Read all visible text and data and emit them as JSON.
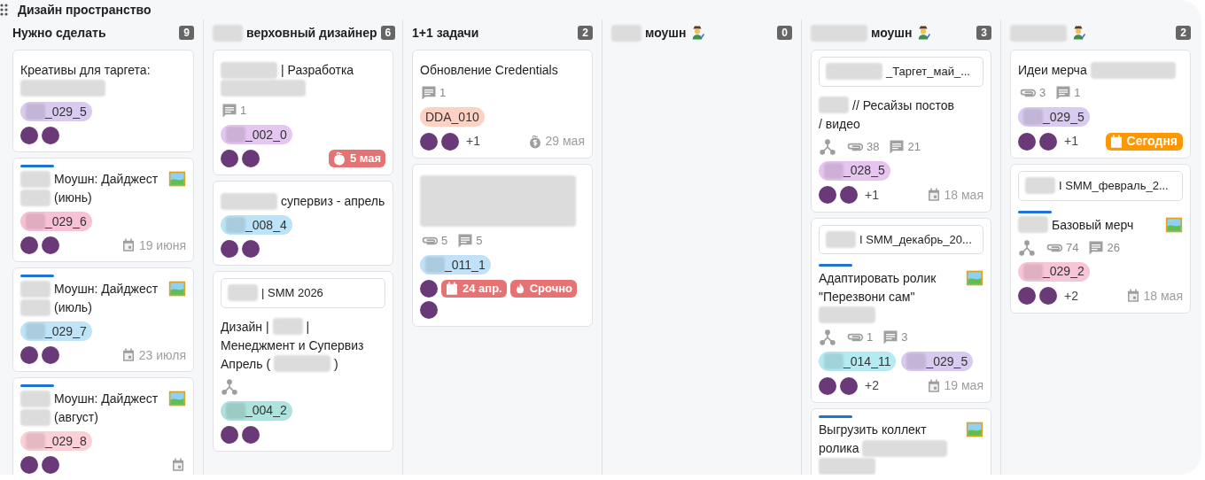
{
  "board": {
    "title": "Дизайн пространство"
  },
  "columns": [
    {
      "title": [
        {
          "kind": "text",
          "text": "Нужно сделать"
        }
      ],
      "artist": false,
      "count": "9",
      "cards": [
        {
          "bar": false,
          "image": false,
          "title": [
            {
              "kind": "text",
              "text": "Креативы для таргета:"
            },
            {
              "kind": "redacted_line"
            }
          ],
          "tags": [
            {
              "redacted": true,
              "text": "_029_5",
              "color": "#d9caef"
            }
          ],
          "avatars": [
            {
              "kind": "photo"
            },
            {
              "kind": "photo"
            }
          ]
        },
        {
          "bar": true,
          "image": true,
          "title": [
            {
              "kind": "redacted"
            },
            {
              "kind": "text",
              "text": "Моушн:"
            },
            {
              "kind": "text",
              "text": "Дайджест"
            },
            {
              "kind": "redacted"
            },
            {
              "kind": "text",
              "text": "(июнь)"
            }
          ],
          "tags": [
            {
              "redacted": true,
              "text": "_029_6",
              "color": "#f8c1d6"
            }
          ],
          "avatars": [
            {
              "kind": "photo"
            },
            {
              "kind": "photo"
            }
          ],
          "due": [
            {
              "kind": "calendar",
              "overdue": false,
              "today": false,
              "text": "19 июня"
            }
          ]
        },
        {
          "bar": true,
          "image": true,
          "title": [
            {
              "kind": "redacted"
            },
            {
              "kind": "text",
              "text": "Моушн:"
            },
            {
              "kind": "text",
              "text": "Дайджест"
            },
            {
              "kind": "redacted"
            },
            {
              "kind": "text",
              "text": "(июль)"
            }
          ],
          "tags": [
            {
              "redacted": true,
              "text": "_029_7",
              "color": "#bfe4f8"
            }
          ],
          "avatars": [
            {
              "kind": "photo"
            },
            {
              "kind": "photo"
            }
          ],
          "due": [
            {
              "kind": "calendar",
              "overdue": false,
              "today": false,
              "text": "23 июля"
            }
          ]
        },
        {
          "bar": true,
          "image": true,
          "title": [
            {
              "kind": "redacted"
            },
            {
              "kind": "text",
              "text": "Моушн:"
            },
            {
              "kind": "text",
              "text": "Дайджест"
            },
            {
              "kind": "redacted"
            },
            {
              "kind": "text",
              "text": "(август)"
            }
          ],
          "tags": [
            {
              "redacted": true,
              "text": "_029_8",
              "color": "#fdd0d8"
            }
          ],
          "avatars": [
            {
              "kind": "photo"
            },
            {
              "kind": "photo"
            }
          ],
          "due": [
            {
              "kind": "calendar",
              "overdue": false,
              "today": false
            }
          ]
        }
      ]
    },
    {
      "title": [
        {
          "kind": "redacted"
        },
        {
          "kind": "text",
          "text": "верховный дизайнер"
        }
      ],
      "artist": false,
      "count": "6",
      "cards": [
        {
          "bar": false,
          "image": false,
          "title": [
            {
              "kind": "redacted_wide"
            },
            {
              "kind": "text",
              "text": "| Разработка"
            },
            {
              "kind": "redacted_line"
            }
          ],
          "meta": {
            "comments": "1"
          },
          "tags": [
            {
              "redacted": true,
              "text": "_002_0",
              "color": "#e4c6f0"
            }
          ],
          "avatars": [
            {
              "kind": "photo"
            },
            {
              "kind": "photo"
            }
          ],
          "due": [
            {
              "kind": "budget",
              "overdue": true,
              "today": false,
              "text": "5 мая"
            }
          ]
        },
        {
          "bar": false,
          "image": false,
          "title": [
            {
              "kind": "redacted_wide"
            },
            {
              "kind": "text",
              "text": "супервиз -"
            },
            {
              "kind": "text",
              "text": "апрель"
            }
          ],
          "tags": [
            {
              "redacted": true,
              "text": "_008_4",
              "color": "#bce3f7"
            }
          ],
          "avatars": [
            {
              "kind": "photo"
            },
            {
              "kind": "photo"
            }
          ]
        },
        {
          "link": [
            {
              "kind": "redacted"
            },
            {
              "kind": "text",
              "text": "| SMM 2026"
            }
          ],
          "bar": false,
          "image": false,
          "title": [
            {
              "kind": "text",
              "text": "Дизайн |"
            },
            {
              "kind": "redacted"
            },
            {
              "kind": "text",
              "text": "|"
            },
            {
              "kind": "text",
              "text": "Менеджмент и Супервиз"
            },
            {
              "kind": "text",
              "text": "Апрель ("
            },
            {
              "kind": "redacted_wide"
            },
            {
              "kind": "text",
              "text": ")"
            }
          ],
          "meta": {
            "subtasks": true
          },
          "tags": [
            {
              "redacted": true,
              "text": "_004_2",
              "color": "#aee2dc"
            }
          ],
          "avatars": [
            {
              "kind": "photo"
            },
            {
              "kind": "photo"
            }
          ]
        }
      ]
    },
    {
      "title": [
        {
          "kind": "text",
          "text": "1+1 задачи"
        }
      ],
      "artist": false,
      "count": "2",
      "cards": [
        {
          "bar": false,
          "image": false,
          "title": [
            {
              "kind": "text",
              "text": "Обновление"
            },
            {
              "kind": "text",
              "text": "Credentials"
            }
          ],
          "meta": {
            "comments": "1"
          },
          "tags": [
            {
              "redacted": false,
              "text": "DDA_010",
              "color": "#fdd2c5"
            }
          ],
          "avatars": [
            {
              "kind": "photo"
            },
            {
              "kind": "photo"
            }
          ],
          "more": "+1",
          "due": [
            {
              "kind": "budget",
              "overdue": false,
              "today": false,
              "text": "29 мая"
            }
          ]
        },
        {
          "bar": false,
          "image": false,
          "title": [
            {
              "kind": "redacted_block"
            }
          ],
          "meta": {
            "attachments": "5",
            "comments": "5"
          },
          "tags": [
            {
              "redacted": true,
              "text": "_011_1",
              "color": "#c0e1f8"
            }
          ],
          "avatars": [
            {
              "kind": "photo"
            },
            {
              "kind": "photo"
            }
          ],
          "due": [
            {
              "kind": "calendar",
              "overdue": true,
              "today": false,
              "text": "24 апр."
            },
            {
              "kind": "urgent",
              "overdue": true,
              "today": false,
              "text": "Срочно"
            }
          ]
        }
      ]
    },
    {
      "title": [
        {
          "kind": "redacted"
        },
        {
          "kind": "text",
          "text": "моушн"
        }
      ],
      "artist": true,
      "count": "0"
    },
    {
      "title": [
        {
          "kind": "redacted_wide"
        },
        {
          "kind": "text",
          "text": "моушн"
        }
      ],
      "artist": true,
      "count": "3",
      "cards": [
        {
          "link": [
            {
              "kind": "redacted_wide"
            },
            {
              "kind": "text",
              "text": "_Таргет_май_..."
            }
          ],
          "bar": false,
          "image": false,
          "title": [
            {
              "kind": "redacted"
            },
            {
              "kind": "text",
              "text": "// Ресайзы постов"
            },
            {
              "kind": "text",
              "text": "/ видео"
            }
          ],
          "meta": {
            "subtasks": true,
            "attachments": "38",
            "comments": "21"
          },
          "tags": [
            {
              "redacted": true,
              "text": "_028_5",
              "color": "#e6c5ef"
            }
          ],
          "avatars": [
            {
              "kind": "photo"
            },
            {
              "kind": "photo"
            }
          ],
          "more": "+1",
          "due": [
            {
              "kind": "calendar",
              "overdue": false,
              "today": false,
              "text": "18 мая"
            }
          ]
        },
        {
          "link": [
            {
              "kind": "redacted"
            },
            {
              "kind": "text",
              "text": "I SMM_декабрь_20..."
            }
          ],
          "bar": true,
          "image": true,
          "title": [
            {
              "kind": "text",
              "text": "Адаптировать ролик"
            },
            {
              "kind": "text",
              "text": "\"Перезвони сам\""
            },
            {
              "kind": "redacted_wide"
            }
          ],
          "meta": {
            "subtasks": true,
            "attachments": "1",
            "comments": "3"
          },
          "tags": [
            {
              "redacted": true,
              "text": "_014_11",
              "color": "#b5eaf2"
            },
            {
              "redacted": true,
              "text": "_029_5",
              "color": "#d9caef"
            }
          ],
          "avatars": [
            {
              "kind": "photo"
            },
            {
              "kind": "photo"
            }
          ],
          "more": "+2",
          "due": [
            {
              "kind": "calendar",
              "overdue": false,
              "today": false,
              "text": "19 мая"
            }
          ]
        },
        {
          "bar": true,
          "image": true,
          "title": [
            {
              "kind": "text",
              "text": "Выгрузить коллект"
            },
            {
              "kind": "text",
              "text": "ролика"
            },
            {
              "kind": "redacted_line"
            },
            {
              "kind": "redacted_wide"
            }
          ]
        }
      ]
    },
    {
      "title": [
        {
          "kind": "redacted_wide"
        }
      ],
      "artist": true,
      "count": "2",
      "cards": [
        {
          "bar": false,
          "image": false,
          "title": [
            {
              "kind": "text",
              "text": "Идеи мерча"
            },
            {
              "kind": "redacted_line"
            }
          ],
          "meta": {
            "attachments": "3",
            "comments": "1"
          },
          "tags": [
            {
              "redacted": true,
              "text": "_029_5",
              "color": "#d9caef"
            }
          ],
          "avatars": [
            {
              "kind": "photo"
            },
            {
              "kind": "photo"
            }
          ],
          "more": "+1",
          "due": [
            {
              "kind": "calendar",
              "overdue": false,
              "today": true,
              "text": "Сегодня"
            }
          ]
        },
        {
          "link": [
            {
              "kind": "redacted"
            },
            {
              "kind": "text",
              "text": "I SMM_февраль_2..."
            }
          ],
          "bar": true,
          "image": true,
          "title": [
            {
              "kind": "redacted"
            },
            {
              "kind": "text",
              "text": "Базовый мерч"
            }
          ],
          "meta": {
            "subtasks": true,
            "attachments": "74",
            "comments": "26"
          },
          "tags": [
            {
              "redacted": true,
              "text": "_029_2",
              "color": "#f8c5d8"
            }
          ],
          "avatars": [
            {
              "kind": "photo"
            },
            {
              "kind": "photo"
            }
          ],
          "more": "+2",
          "due": [
            {
              "kind": "calendar",
              "overdue": false,
              "today": false,
              "text": "18 мая"
            }
          ]
        }
      ]
    }
  ]
}
